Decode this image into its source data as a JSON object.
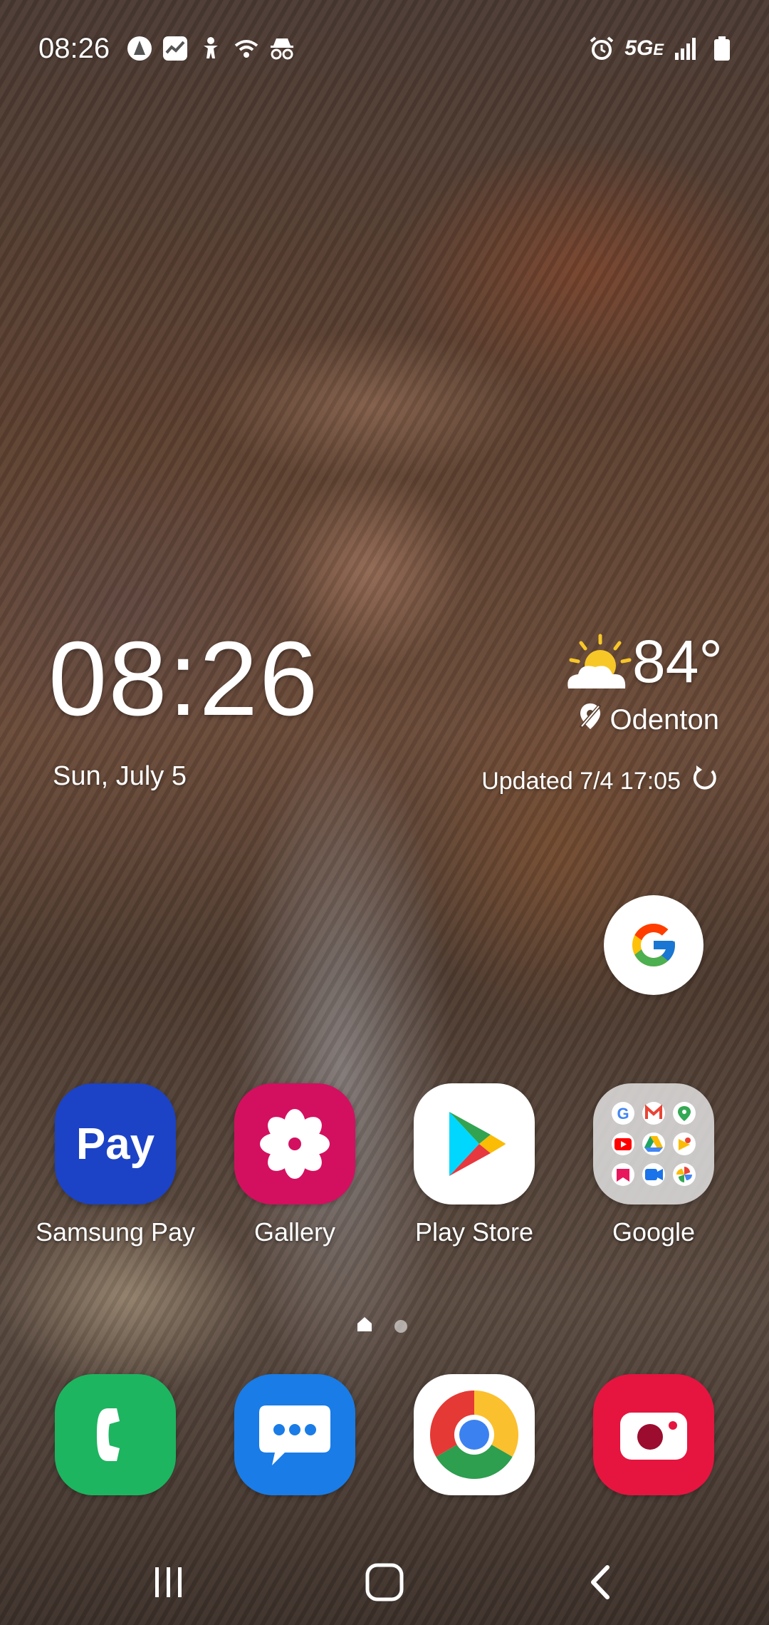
{
  "status_bar": {
    "time": "08:26",
    "network": "5G",
    "network_suffix": "E",
    "left_icons": [
      "notification-a-icon",
      "activity-icon",
      "accessibility-icon",
      "wifi-question-icon",
      "incognito-icon"
    ],
    "right_icons": [
      "alarm-icon",
      "signal-icon",
      "battery-icon"
    ]
  },
  "clock_widget": {
    "time": "08:26",
    "date": "Sun, July 5"
  },
  "weather_widget": {
    "temperature": "84°",
    "location": "Odenton",
    "updated": "Updated 7/4 17:05",
    "icon": "partly-sunny-icon"
  },
  "google_widget": {
    "icon": "google-g-icon"
  },
  "apps": [
    {
      "label": "Samsung Pay",
      "icon_text": "Pay",
      "color": "#1c43c6"
    },
    {
      "label": "Gallery",
      "color": "#d3105f"
    },
    {
      "label": "Play Store",
      "color": "#ffffff"
    },
    {
      "label": "Google",
      "color": "#d9d9d9"
    }
  ],
  "dock": [
    {
      "name": "Phone",
      "color": "#1db560"
    },
    {
      "name": "Messages",
      "color": "#1a7ce6"
    },
    {
      "name": "Chrome",
      "color": "#ffffff"
    },
    {
      "name": "Camera",
      "color": "#e5153f"
    }
  ],
  "pager": {
    "pages": 2,
    "current": 1
  },
  "navbar": [
    "recents-icon",
    "home-icon",
    "back-icon"
  ]
}
